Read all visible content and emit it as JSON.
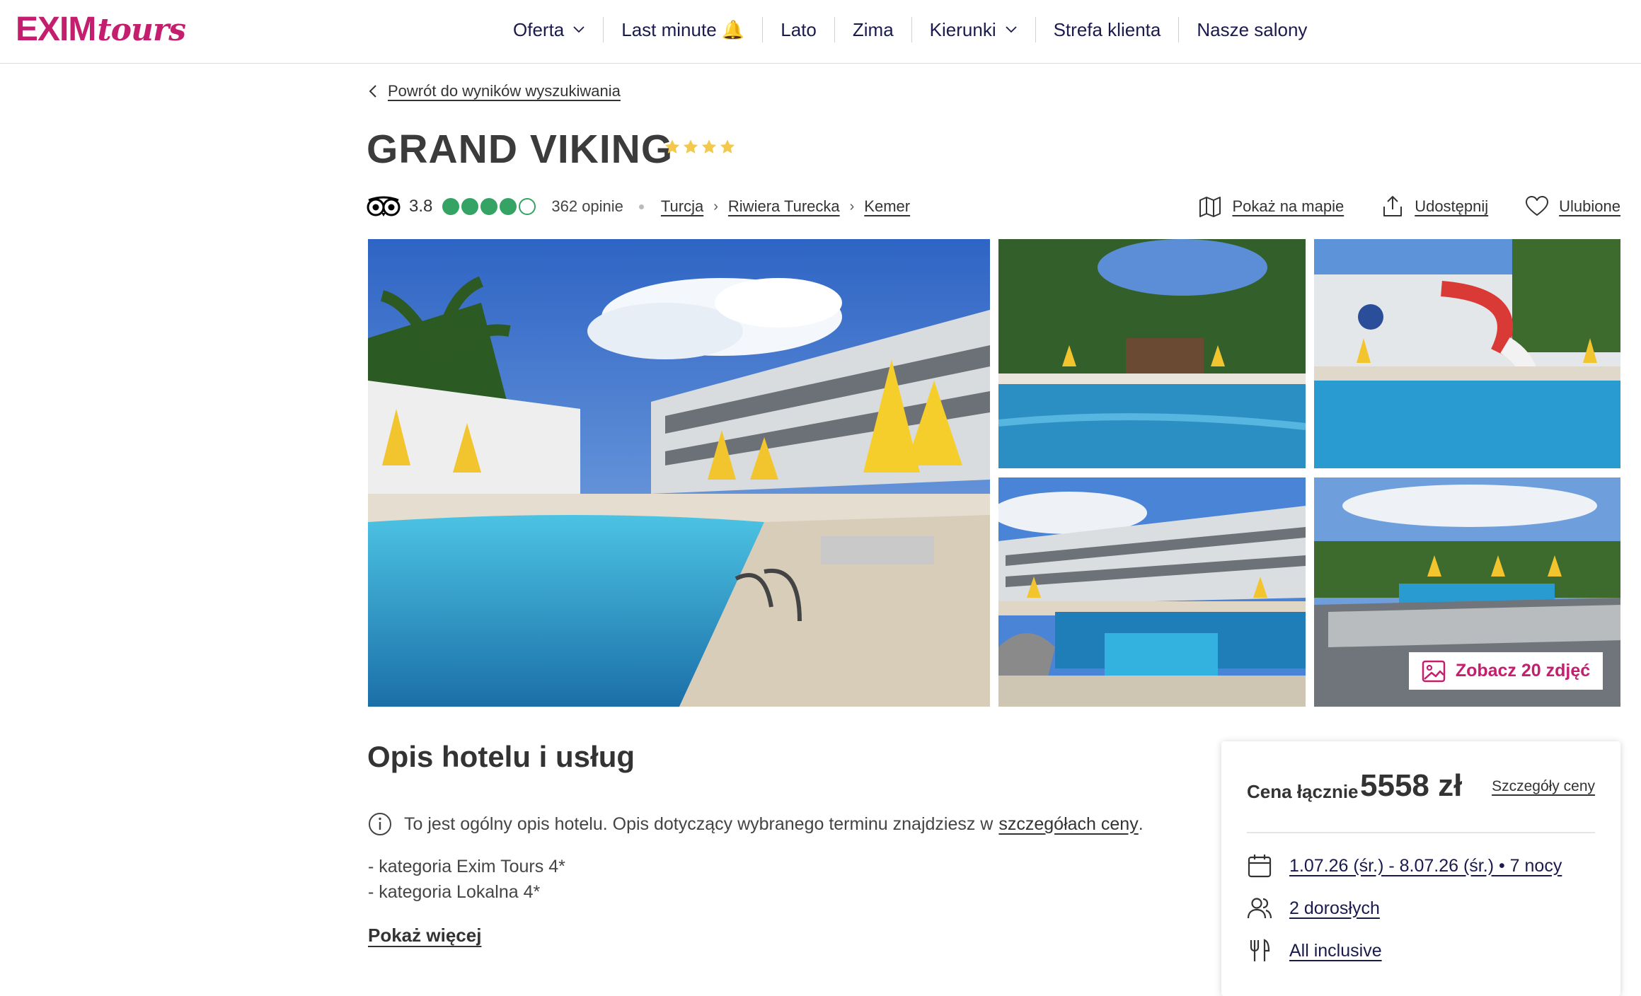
{
  "brand": {
    "logo_main": "EXIM",
    "logo_script": "tours",
    "color": "#c41e6e"
  },
  "nav": {
    "items": [
      {
        "label": "Oferta",
        "dropdown": true
      },
      {
        "label": "Last minute 🔔",
        "dropdown": false
      },
      {
        "label": "Lato",
        "dropdown": false
      },
      {
        "label": "Zima",
        "dropdown": false
      },
      {
        "label": "Kierunki",
        "dropdown": true
      },
      {
        "label": "Strefa klienta",
        "dropdown": false
      },
      {
        "label": "Nasze salony",
        "dropdown": false
      }
    ]
  },
  "back_link": "Powrót do wyników wyszukiwania",
  "hotel": {
    "name": "GRAND VIKING",
    "star_count": 4,
    "rating": "3.8",
    "rating_bubbles_filled": 4,
    "rating_bubbles_total": 5,
    "reviews": "362 opinie",
    "breadcrumb": [
      "Turcja",
      "Riwiera Turecka",
      "Kemer"
    ]
  },
  "actions": {
    "map": "Pokaż na mapie",
    "share": "Udostępnij",
    "favorite": "Ulubione"
  },
  "gallery": {
    "see_photos": "Zobacz 20 zdjęć"
  },
  "description": {
    "title": "Opis hotelu i usług",
    "info_text": "To jest ogólny opis hotelu. Opis dotyczący wybranego terminu znajdziesz w",
    "info_link": "szczegółach ceny",
    "info_end": ".",
    "lines": [
      "- kategoria Exim Tours 4*",
      "- kategoria Lokalna 4*"
    ],
    "show_more": "Pokaż więcej"
  },
  "price": {
    "label": "Cena łącznie",
    "value": "5558 zł",
    "details_link": "Szczegóły ceny",
    "dates": "1.07.26 (śr.) - 8.07.26 (śr.) • 7 nocy",
    "guests": "2 dorosłych",
    "board": "All inclusive"
  },
  "colors": {
    "accent": "#c41e6e",
    "nav_text": "#1a1a4d",
    "tripadvisor_green": "#34a363",
    "star_yellow": "#f2c94c"
  }
}
